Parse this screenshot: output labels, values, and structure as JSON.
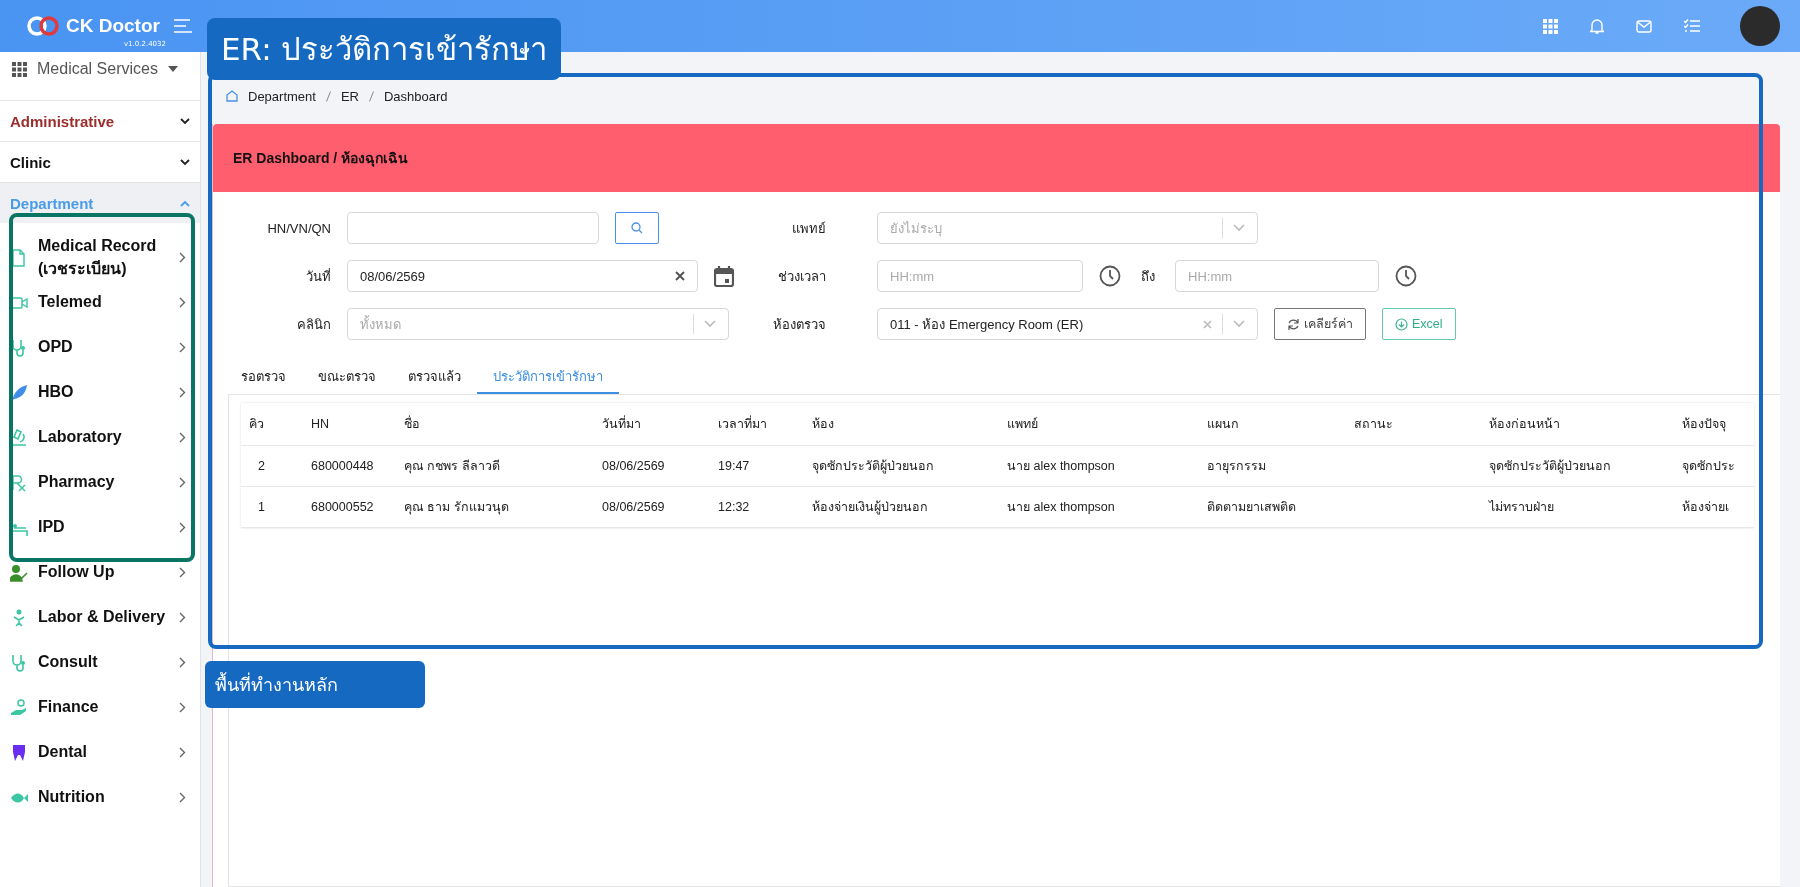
{
  "topbar": {
    "brand": "CK Doctor",
    "version": "v1.0.2.4032"
  },
  "sidebar": {
    "module": "Medical Services",
    "sections": [
      {
        "label": "Administrative",
        "expanded": false,
        "color": "#9b2d2d"
      },
      {
        "label": "Clinic",
        "expanded": false,
        "color": "#111111"
      },
      {
        "label": "Department",
        "expanded": true,
        "color": "#4a9be8"
      }
    ],
    "items": [
      "Medical Record (เวชระเบียน)",
      "Telemed",
      "OPD",
      "HBO",
      "Laboratory",
      "Pharmacy",
      "IPD",
      "Follow Up",
      "Labor & Delivery",
      "Consult",
      "Finance",
      "Dental",
      "Nutrition"
    ]
  },
  "breadcrumb": [
    "Department",
    "ER",
    "Dashboard"
  ],
  "header": {
    "title": "ER Dashboard / ห้องฉุกเฉิน"
  },
  "filters": [
    {
      "kind": "search",
      "label": "HN/VN/QN"
    },
    {
      "kind": "date",
      "label": "วันที่",
      "value": "08/06/2569"
    },
    {
      "kind": "select",
      "label": "คลินิก",
      "placeholder": "ทั้งหมด"
    },
    {
      "kind": "select",
      "label": "แพทย์",
      "placeholder": "ยังไม่ระบุ"
    },
    {
      "kind": "timerange",
      "label": "ช่วงเวลา",
      "from_placeholder": "HH:mm",
      "to_label": "ถึง",
      "to_placeholder": "HH:mm"
    },
    {
      "kind": "select",
      "label": "ห้องตรวจ",
      "value": "011 - ห้อง Emergency Room (ER)",
      "clearable": true
    }
  ],
  "actions": [
    {
      "kind": "clear",
      "label": "เคลียร์ค่า"
    },
    {
      "kind": "excel",
      "label": "Excel"
    }
  ],
  "tabs": [
    {
      "label": "รอตรวจ",
      "selected": false
    },
    {
      "label": "ขณะตรวจ",
      "selected": false
    },
    {
      "label": "ตรวจแล้ว",
      "selected": false
    },
    {
      "label": "ประวัติการเข้ารักษา",
      "selected": true
    }
  ],
  "table": {
    "columns": [
      "คิว",
      "HN",
      "ชื่อ",
      "วันที่มา",
      "เวลาที่มา",
      "ห้อง",
      "แพทย์",
      "แผนก",
      "สถานะ",
      "ห้องก่อนหน้า",
      "ห้องปัจจุ"
    ],
    "rows": [
      [
        "2",
        "680000448",
        "คุณ กชพร ลีลาวดี",
        "08/06/2569",
        "19:47",
        "จุดซักประวัติผู้ป่วยนอก",
        "นาย alex thompson",
        "อายุรกรรม",
        "",
        "จุดซักประวัติผู้ป่วยนอก",
        "จุดซักประ"
      ],
      [
        "1",
        "680000552",
        "คุณ ธาม รักแมวนุด",
        "08/06/2569",
        "12:32",
        "ห้องจ่ายเงินผู้ป่วยนอก",
        "นาย alex thompson",
        "ติดตามยาเสพติด",
        "",
        "ไม่ทราบฝ่าย",
        "ห้องจ่ายเ"
      ]
    ]
  },
  "annotations": {
    "title": "ER: ประวัติการเข้ารักษา",
    "area_label": "พื้นที่ทำงานหลัก"
  }
}
